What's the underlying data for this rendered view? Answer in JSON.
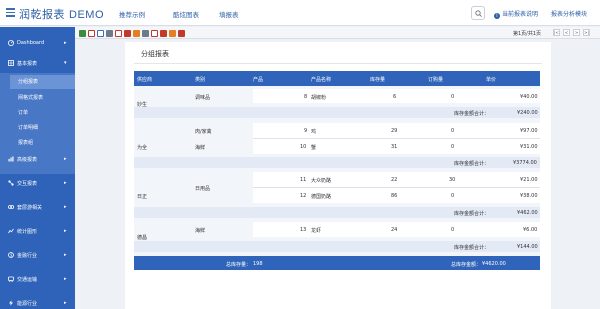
{
  "header": {
    "app_title": "润乾报表",
    "app_suffix": "DEMO",
    "nav": [
      "推荐示例",
      "酷炫图表",
      "填报表"
    ],
    "info_link": "当前报表说明",
    "module_link": "报表分析模块"
  },
  "sidebar": {
    "items": [
      {
        "label": "Dashboard",
        "icon": "dashboard-icon"
      },
      {
        "label": "基本报表",
        "icon": "grid-icon"
      },
      {
        "label": "高级报表",
        "icon": "chart-icon"
      },
      {
        "label": "交互报表",
        "icon": "interactive-icon"
      },
      {
        "label": "套层游相关",
        "icon": "layers-icon"
      },
      {
        "label": "统计图形",
        "icon": "stats-icon"
      },
      {
        "label": "金融行业",
        "icon": "finance-icon"
      },
      {
        "label": "交通运输",
        "icon": "transport-icon"
      },
      {
        "label": "能源行业",
        "icon": "energy-icon"
      }
    ],
    "submenu": [
      "分组报表",
      "网格式报表",
      "订单",
      "订单明细",
      "报表组"
    ]
  },
  "toolbar": {
    "pager_text": "第1页/共1页",
    "pager_buttons": [
      "|<",
      "<",
      ">",
      ">|"
    ]
  },
  "panel": {
    "title": "分组报表"
  },
  "table": {
    "columns": [
      "供应商",
      "类别",
      "产品",
      "产品名称",
      "库存量",
      "订购量",
      "单价"
    ],
    "groups": [
      {
        "supplier": "妙生",
        "rows": [
          {
            "category": "调味品",
            "product_id": "8",
            "product_name": "胡椒粉",
            "stock": "6",
            "order": "0",
            "price": "¥40.00"
          }
        ],
        "subtotal_label": "库存金额合计：",
        "subtotal": "¥240.00"
      },
      {
        "supplier": "为全",
        "rows": [
          {
            "category": "肉/家禽",
            "product_id": "9",
            "product_name": "鸡",
            "stock": "29",
            "order": "0",
            "price": "¥97.00"
          },
          {
            "category": "海鲜",
            "product_id": "10",
            "product_name": "蟹",
            "stock": "31",
            "order": "0",
            "price": "¥31.00"
          }
        ],
        "subtotal_label": "库存金额合计：",
        "subtotal": "¥3774.00"
      },
      {
        "supplier": "日正",
        "rows": [
          {
            "category": "日用品",
            "product_id": "11",
            "product_name": "大众奶酪",
            "stock": "22",
            "order": "30",
            "price": "¥21.00"
          },
          {
            "category": "",
            "product_id": "12",
            "product_name": "德国奶酪",
            "stock": "86",
            "order": "0",
            "price": "¥38.00"
          }
        ],
        "subtotal_label": "库存金额合计：",
        "subtotal": "¥462.00"
      },
      {
        "supplier": "德昌",
        "rows": [
          {
            "category": "海鲜",
            "product_id": "13",
            "product_name": "龙虾",
            "stock": "24",
            "order": "0",
            "price": "¥6.00"
          }
        ],
        "subtotal_label": "库存金额合计：",
        "subtotal": "¥144.00"
      }
    ],
    "total_stock_label": "总库存量：",
    "total_stock": "198",
    "total_amount_label": "总库存金额：",
    "total_amount": "¥4620.00"
  },
  "colors": {
    "accent": "#2f64ba",
    "sidebar": "#2e63b9",
    "submenu": "#4877c6"
  }
}
